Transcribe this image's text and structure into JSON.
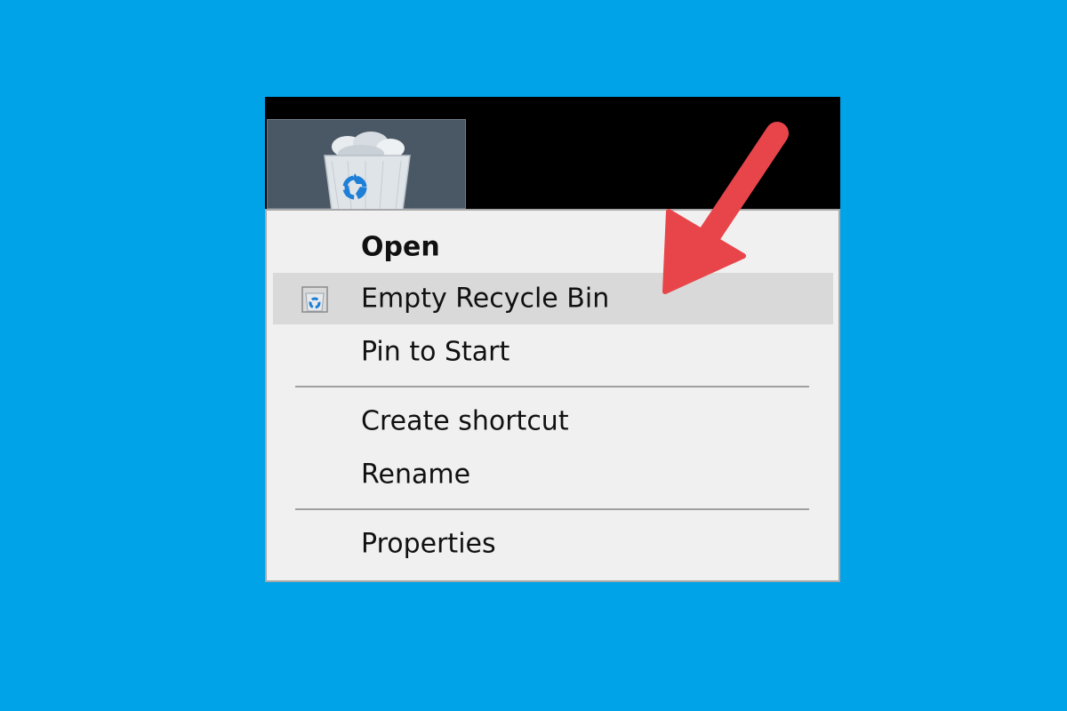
{
  "desktop": {
    "background_color": "#00a2e8",
    "icon": {
      "name": "recycle-bin",
      "selected": true
    }
  },
  "context_menu": {
    "items": [
      {
        "label": "Open",
        "bold": true
      },
      {
        "label": "Empty Recycle Bin",
        "icon": "recycle-bin-icon",
        "highlighted": true
      },
      {
        "label": "Pin to Start"
      },
      {
        "label": "Create shortcut"
      },
      {
        "label": "Rename"
      },
      {
        "label": "Properties"
      }
    ]
  },
  "annotation": {
    "type": "arrow",
    "color": "#e8454a",
    "points_to": "Empty Recycle Bin"
  }
}
